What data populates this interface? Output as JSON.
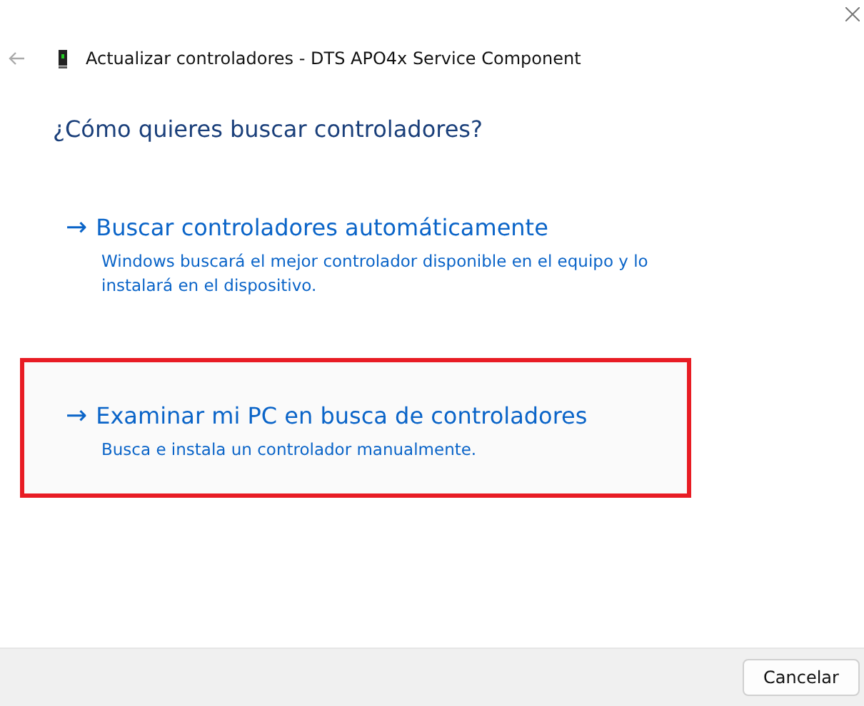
{
  "window": {
    "title": "Actualizar controladores - DTS APO4x Service Component"
  },
  "heading": "¿Cómo quieres buscar controladores?",
  "options": [
    {
      "arrow": "→",
      "title": "Buscar controladores automáticamente",
      "description": "Windows buscará el mejor controlador disponible en el equipo y lo instalará en el dispositivo.",
      "highlighted": false
    },
    {
      "arrow": "→",
      "title": "Examinar mi PC en busca de controladores",
      "description": "Busca e instala un controlador manualmente.",
      "highlighted": true
    }
  ],
  "buttons": [
    "Cancelar"
  ]
}
